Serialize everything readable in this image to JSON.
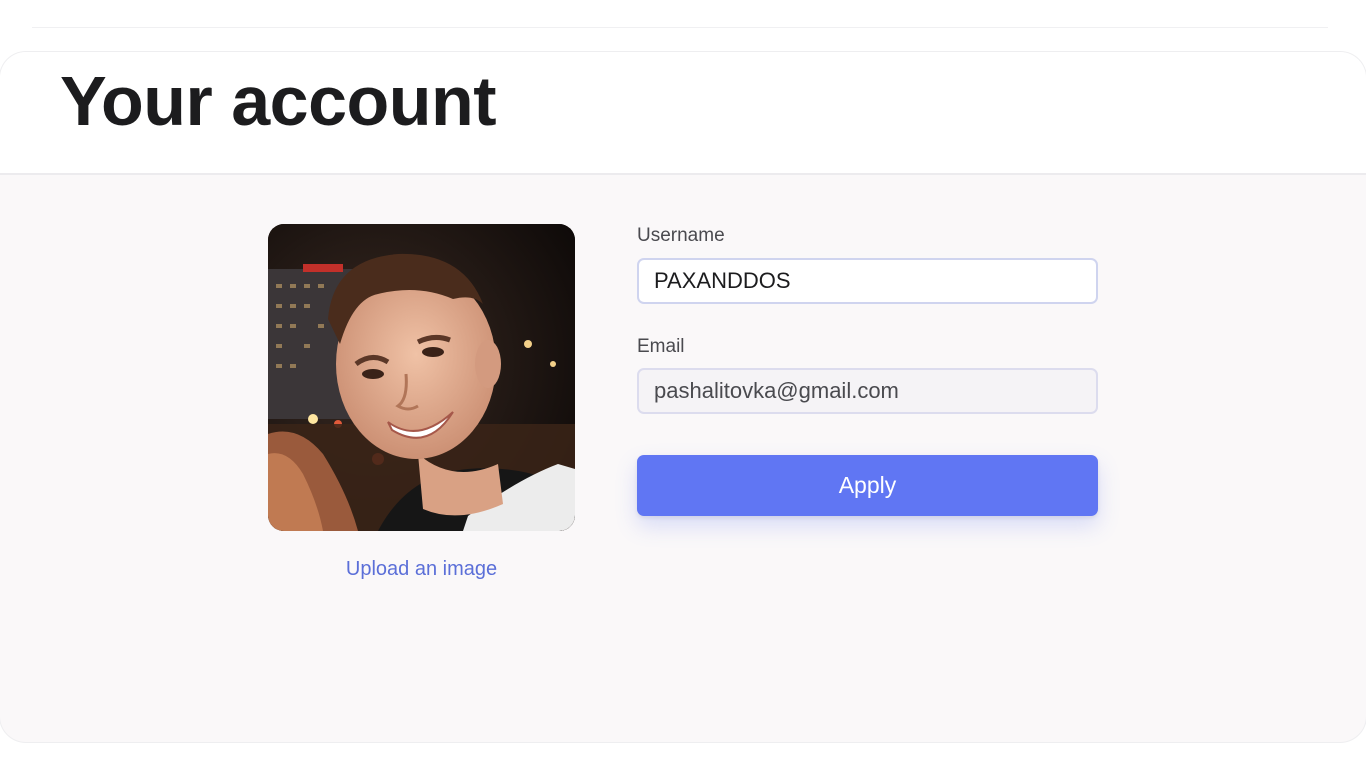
{
  "page": {
    "title": "Your account"
  },
  "profile": {
    "upload_label": "Upload an image"
  },
  "form": {
    "username": {
      "label": "Username",
      "value": "PAXANDDOS"
    },
    "email": {
      "label": "Email",
      "value": "pashalitovka@gmail.com"
    },
    "apply_label": "Apply"
  },
  "colors": {
    "accent": "#6076f3",
    "link": "#5b6fd8",
    "title": "#1c1c1e",
    "panel_background": "#faf8f9"
  }
}
